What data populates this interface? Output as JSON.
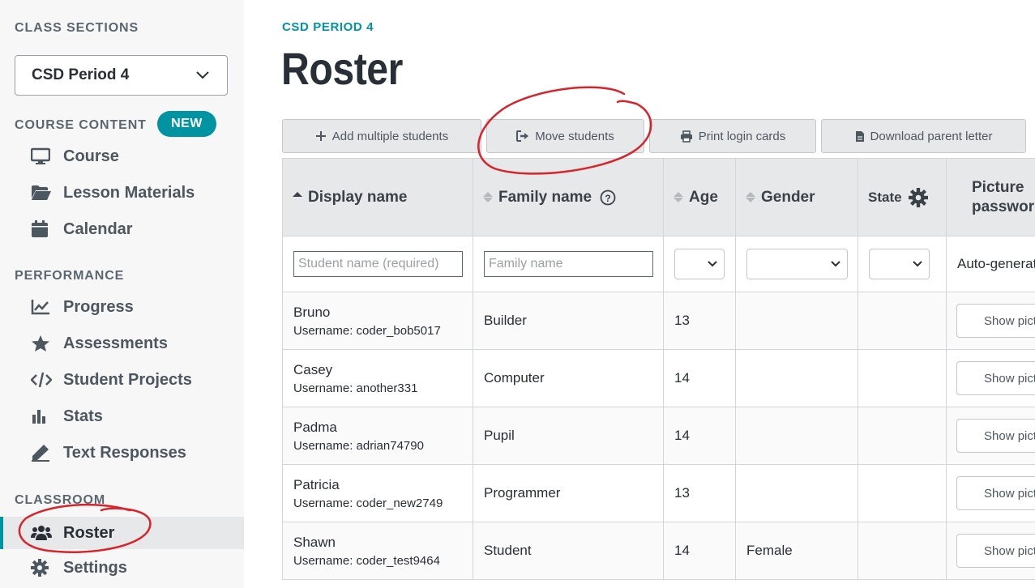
{
  "sidebar": {
    "class_sections_label": "CLASS SECTIONS",
    "selected_section": "CSD Period 4",
    "course_content_label": "COURSE CONTENT",
    "new_badge": "NEW",
    "course_items": [
      {
        "label": "Course",
        "icon": "monitor-icon"
      },
      {
        "label": "Lesson Materials",
        "icon": "folder-open-icon"
      },
      {
        "label": "Calendar",
        "icon": "calendar-icon"
      }
    ],
    "performance_label": "PERFORMANCE",
    "performance_items": [
      {
        "label": "Progress",
        "icon": "line-chart-icon"
      },
      {
        "label": "Assessments",
        "icon": "star-icon"
      },
      {
        "label": "Student Projects",
        "icon": "code-icon"
      },
      {
        "label": "Stats",
        "icon": "bar-chart-icon"
      },
      {
        "label": "Text Responses",
        "icon": "pen-icon"
      }
    ],
    "classroom_label": "CLASSROOM",
    "classroom_items": [
      {
        "label": "Roster",
        "icon": "users-icon",
        "active": true
      },
      {
        "label": "Settings",
        "icon": "gear-icon"
      }
    ]
  },
  "header": {
    "breadcrumb": "CSD PERIOD 4",
    "title": "Roster"
  },
  "toolbar": {
    "add_multiple": "Add multiple students",
    "move_students": "Move students",
    "print_cards": "Print login cards",
    "download_letter": "Download parent letter"
  },
  "table": {
    "columns": [
      "Display name",
      "Family name",
      "Age",
      "Gender",
      "State",
      "Picture password"
    ],
    "add_row": {
      "name_placeholder": "Student name (required)",
      "family_placeholder": "Family name",
      "password_text": "Auto-generated"
    },
    "username_prefix": "Username: ",
    "show_picture_label": "Show picture",
    "rows": [
      {
        "name": "Bruno",
        "username": "coder_bob5017",
        "family": "Builder",
        "age": "13",
        "gender": ""
      },
      {
        "name": "Casey",
        "username": "another331",
        "family": "Computer",
        "age": "14",
        "gender": ""
      },
      {
        "name": "Padma",
        "username": "adrian74790",
        "family": "Pupil",
        "age": "14",
        "gender": ""
      },
      {
        "name": "Patricia",
        "username": "coder_new2749",
        "family": "Programmer",
        "age": "13",
        "gender": ""
      },
      {
        "name": "Shawn",
        "username": "coder_test9464",
        "family": "Student",
        "age": "14",
        "gender": "Female"
      }
    ]
  },
  "colors": {
    "accent": "#0094a3",
    "annotation": "#d8232a"
  }
}
